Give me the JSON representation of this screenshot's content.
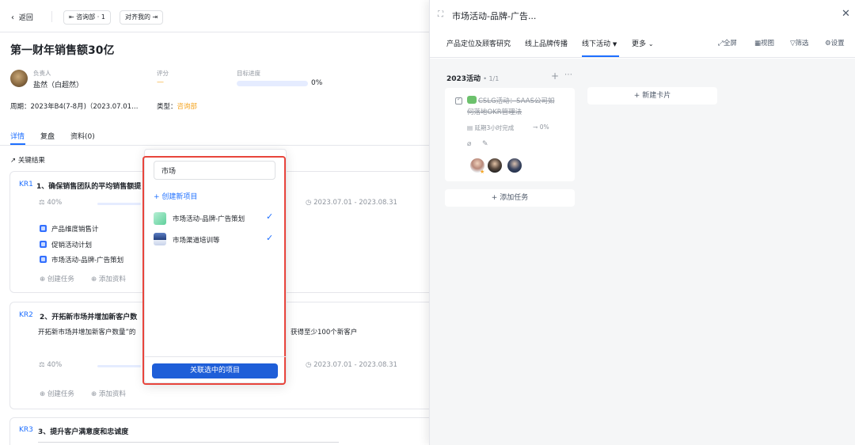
{
  "left": {
    "back_label": "返回",
    "dept_button": "咨询部 · 1",
    "align_button": "对齐我的",
    "title": "第一财年销售额30亿",
    "owner_label": "负责人",
    "owner_name": "盐然（白超然）",
    "score_label": "评分",
    "score_value": "—",
    "progress_label": "目标进度",
    "progress_value": "0%",
    "period_text": "周期：2023年B4(7-8月)（2023.07.01…",
    "type_label": "类型：",
    "type_value": "咨询部",
    "tabs": [
      "详情",
      "复盘",
      "资料(0)"
    ],
    "section_title": "关键结果",
    "kr1": {
      "tag": "KR1",
      "title": "1、确保销售团队的平均销售额提",
      "weight": "40%",
      "date": "2023.07.01 - 2023.08.31",
      "tasks": [
        "产品维度销售计",
        "促销活动计划",
        "市场活动-品牌-广告策划"
      ],
      "create_task": "创建任务",
      "add_material": "添加资料"
    },
    "kr2": {
      "tag": "KR2",
      "title": "2、开拓新市场并增加新客户数",
      "desc_left": "开拓新市场并增加新客户数量”的",
      "desc_right": "获得至少100个新客户",
      "weight": "40%",
      "date": "2023.07.01 - 2023.08.31",
      "create_task": "创建任务",
      "add_material": "添加资料"
    },
    "kr3": {
      "tag": "KR3",
      "title": "3、提升客户满意度和忠诚度"
    }
  },
  "dropdown": {
    "search_value": "市场",
    "create_new": "创建新项目",
    "items": [
      {
        "label": "市场活动-品牌-广告策划",
        "checked": true
      },
      {
        "label": "市场渠道培训等",
        "checked": true
      }
    ],
    "submit_label": "关联选中的项目"
  },
  "right": {
    "title": "市场活动-品牌-广告...",
    "tabs": [
      "产品定位及顾客研究",
      "线上品牌传播",
      "线下活动",
      "更多"
    ],
    "tools": [
      "全屏",
      "视图",
      "筛选",
      "设置"
    ],
    "column": {
      "name": "2023活动",
      "count": "• 1/1",
      "card_title_line1": "CSLG活动：SAAS公司如",
      "card_title_line2": "何落地OKR管理法",
      "delay_text": "延期3小时完成",
      "progress": "0%",
      "add_task": "添加任务"
    },
    "new_card": "新建卡片"
  },
  "colors": {
    "accent": "#1e6fff",
    "highlight_border": "#e8453c",
    "orange": "#f5a623"
  }
}
